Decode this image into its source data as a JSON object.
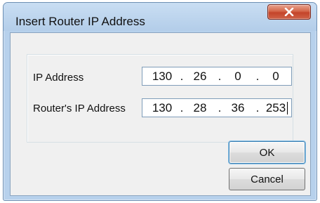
{
  "window": {
    "title": "Insert Router IP Address"
  },
  "fields": {
    "ip_label": "IP Address",
    "ip_octets": [
      "130",
      "26",
      "0",
      "0"
    ],
    "router_label": "Router's IP Address",
    "router_octets": [
      "130",
      "28",
      "36",
      "253"
    ]
  },
  "separator": ".",
  "buttons": {
    "ok_label": "OK",
    "cancel_label": "Cancel"
  },
  "icons": {
    "close": "close-icon"
  }
}
